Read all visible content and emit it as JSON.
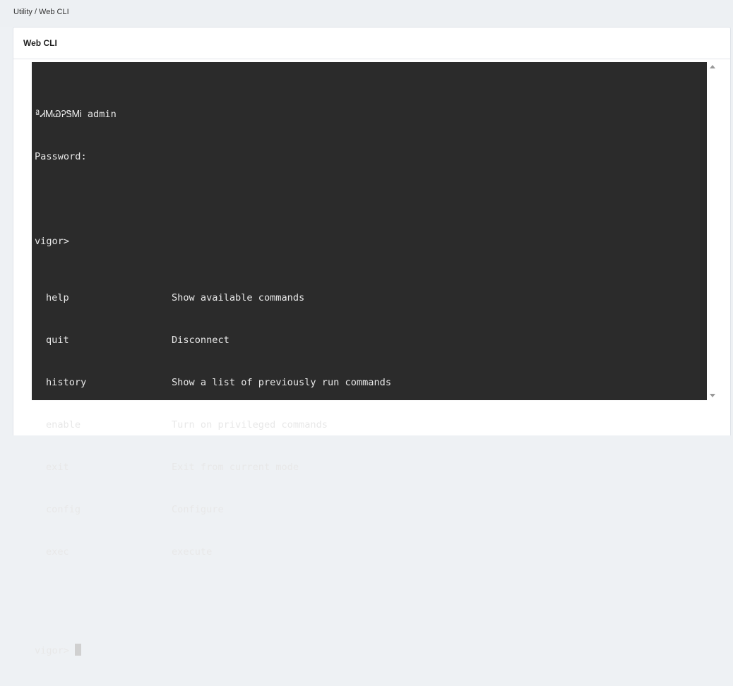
{
  "breadcrumb": "Utility / Web CLI",
  "panel": {
    "title": "Web CLI"
  },
  "terminal": {
    "login_prompt": "ªᏗᎷᏊᎮᏕᎷᎥ admin",
    "password_prompt": "Password:",
    "prompt1": "vigor>",
    "commands": [
      {
        "name": "help",
        "desc": "Show available commands"
      },
      {
        "name": "quit",
        "desc": "Disconnect"
      },
      {
        "name": "history",
        "desc": "Show a list of previously run commands"
      },
      {
        "name": "enable",
        "desc": "Turn on privileged commands"
      },
      {
        "name": "exit",
        "desc": "Exit from current mode"
      },
      {
        "name": "config",
        "desc": "Configure"
      },
      {
        "name": "exec",
        "desc": "execute"
      }
    ],
    "prompt2": "vigor> "
  },
  "colors": {
    "terminal_bg": "#2b2b2b",
    "terminal_fg": "#e8e8e8",
    "page_bg": "#eef1f4"
  }
}
